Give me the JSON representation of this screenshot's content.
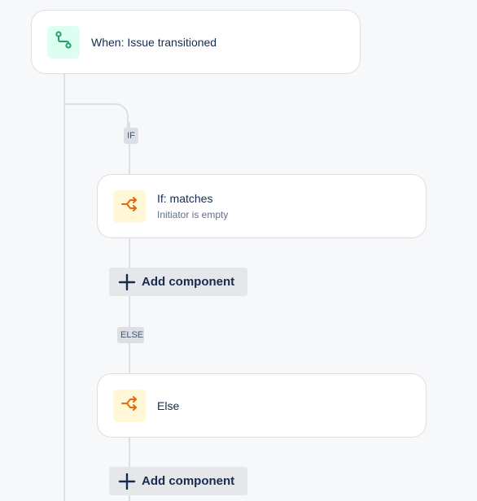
{
  "trigger": {
    "title": "When: Issue transitioned",
    "icon": "branch-route-icon",
    "icon_color": "#22a06b"
  },
  "branches": {
    "if_label": "IF",
    "else_label": "ELSE"
  },
  "condition": {
    "title": "If: matches",
    "subtitle": "Initiator is empty",
    "icon": "condition-branch-icon",
    "icon_color": "#e56910"
  },
  "else_block": {
    "title": "Else",
    "icon": "condition-branch-icon",
    "icon_color": "#e56910"
  },
  "actions": {
    "add_component_label": "Add component",
    "add_component_label_2": "Add component"
  }
}
